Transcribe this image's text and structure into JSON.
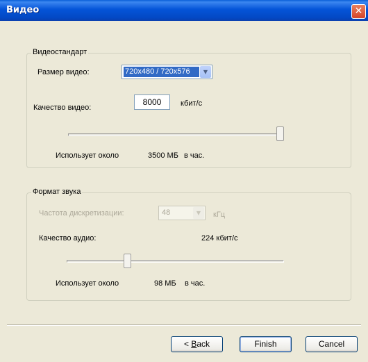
{
  "window": {
    "title": "Видео",
    "close_glyph": "✕"
  },
  "video_group": {
    "title": "Видеостандарт",
    "size_label": "Размер видео:",
    "size_value": "720x480 / 720x576",
    "quality_label": "Качество видео:",
    "quality_value": "8000",
    "quality_unit": "кбит/с",
    "slider_level": 1.0,
    "usage_prefix": "Использует около",
    "usage_value": "3500 МБ",
    "usage_suffix": "в час."
  },
  "audio_group": {
    "title": "Формат звука",
    "rate_label": "Частота дискретизации:",
    "rate_value": "48",
    "rate_unit": "кГц",
    "quality_label": "Качество аудио:",
    "quality_value": "224 кбит/с",
    "slider_level": 0.27,
    "usage_prefix": "Использует около",
    "usage_value": "98 МБ",
    "usage_suffix": "в час."
  },
  "buttons": {
    "back_prefix": "< ",
    "back_hotkey": "B",
    "back_rest": "ack",
    "finish": "Finish",
    "cancel": "Cancel"
  },
  "icons": {
    "dropdown": "chevron-down-icon",
    "close": "close-icon"
  }
}
